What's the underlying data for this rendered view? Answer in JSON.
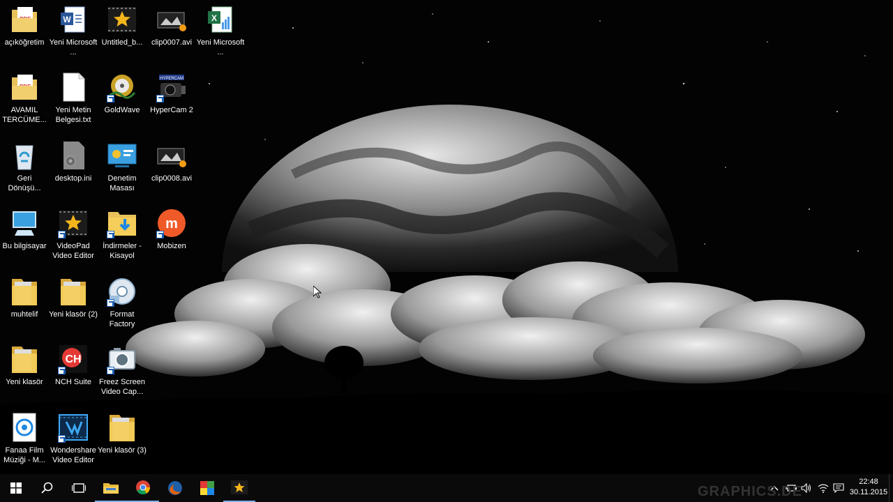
{
  "desktop": {
    "icons": [
      {
        "label": "açıköğretim",
        "icon": "pdf-folder-icon"
      },
      {
        "label": "Yeni Microsoft ...",
        "icon": "word-document-icon"
      },
      {
        "label": "Untitled_b...",
        "icon": "videopad-project-icon"
      },
      {
        "label": "clip0007.avi",
        "icon": "video-file-icon"
      },
      {
        "label": "Yeni Microsoft ...",
        "icon": "excel-document-icon"
      },
      {
        "label": "AVAMIL TERCÜME...",
        "icon": "pdf-folder-icon"
      },
      {
        "label": "Yeni Metin Belgesi.txt",
        "icon": "text-file-icon"
      },
      {
        "label": "GoldWave",
        "icon": "goldwave-app-icon"
      },
      {
        "label": "HyperCam 2",
        "icon": "hypercam-app-icon"
      },
      {
        "label": "Geri Dönüşü...",
        "icon": "recycle-bin-icon"
      },
      {
        "label": "desktop.ini",
        "icon": "settings-file-icon"
      },
      {
        "label": "Denetim Masası",
        "icon": "control-panel-icon"
      },
      {
        "label": "clip0008.avi",
        "icon": "video-file-icon"
      },
      {
        "label": "Bu bilgisayar",
        "icon": "computer-icon"
      },
      {
        "label": "VideoPad Video Editor",
        "icon": "videopad-app-icon"
      },
      {
        "label": "İndirmeler - Kisayol",
        "icon": "downloads-folder-icon"
      },
      {
        "label": "Mobizen",
        "icon": "mobizen-app-icon"
      },
      {
        "label": "muhtelif",
        "icon": "folder-icon"
      },
      {
        "label": "Yeni klasör (2)",
        "icon": "folder-icon"
      },
      {
        "label": "Format Factory",
        "icon": "format-factory-app-icon"
      },
      {
        "label": "Yeni klasör",
        "icon": "folder-icon"
      },
      {
        "label": "NCH Suite",
        "icon": "nch-suite-app-icon"
      },
      {
        "label": "Freez Screen Video Cap...",
        "icon": "camera-app-icon"
      },
      {
        "label": "Fanaa Film Müziği - M...",
        "icon": "media-file-icon"
      },
      {
        "label": "Wondershare Video Editor",
        "icon": "wondershare-app-icon"
      },
      {
        "label": "Yeni klasör (3)",
        "icon": "folder-icon"
      }
    ]
  },
  "taskbar": {
    "buttons": [
      {
        "icon": "windows-start-icon"
      },
      {
        "icon": "search-icon"
      },
      {
        "icon": "task-view-icon"
      },
      {
        "icon": "file-explorer-icon"
      },
      {
        "icon": "chrome-icon"
      },
      {
        "icon": "firefox-icon"
      },
      {
        "icon": "paint-icon"
      },
      {
        "icon": "videopad-icon"
      }
    ],
    "tray": {
      "icons": [
        "chevron-up-icon",
        "battery-icon",
        "volume-icon",
        "wifi-icon",
        "notification-icon"
      ],
      "time": "22:48",
      "date": "30.11.2015"
    },
    "watermark": "GRAPHICS.DE"
  },
  "colors": {
    "taskbar": "#0a0a0a",
    "accent": "#7fb0e6",
    "folder": "#e8c15a"
  }
}
